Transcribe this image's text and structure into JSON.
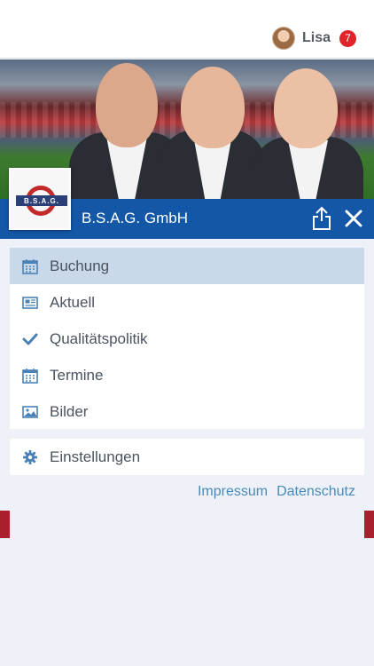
{
  "header": {
    "user_name": "Lisa",
    "notification_count": "7",
    "avatar_icon": "user-avatar"
  },
  "company": {
    "name": "B.S.A.G. GmbH",
    "logo_text": "B.S.A.G."
  },
  "titlebar": {
    "color": "#1357a6",
    "share_icon": "share-icon",
    "close_icon": "close-icon"
  },
  "menu": {
    "items": [
      {
        "label": "Buchung",
        "icon": "calendar-icon",
        "active": true
      },
      {
        "label": "Aktuell",
        "icon": "newspaper-icon",
        "active": false
      },
      {
        "label": "Qualitätspolitik",
        "icon": "checkmark-icon",
        "active": false
      },
      {
        "label": "Termine",
        "icon": "calendar-icon",
        "active": false
      },
      {
        "label": "Bilder",
        "icon": "image-icon",
        "active": false
      }
    ],
    "settings": {
      "label": "Einstellungen",
      "icon": "gear-icon"
    }
  },
  "footer": {
    "impressum": "Impressum",
    "datenschutz": "Datenschutz"
  },
  "colors": {
    "accent": "#1357a6",
    "icon": "#4a82b8",
    "active_bg": "#c9d9ea",
    "badge": "#e0222b",
    "side_red": "#a91f2d"
  }
}
